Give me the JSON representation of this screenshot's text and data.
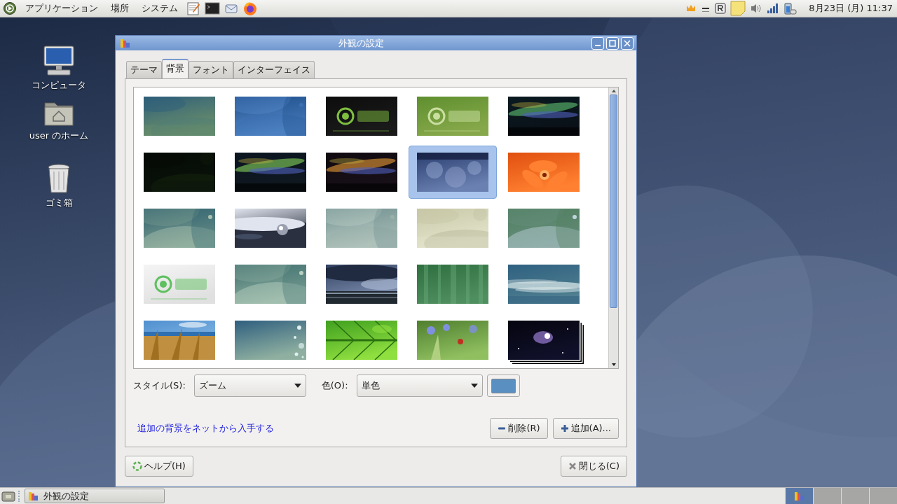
{
  "top_panel": {
    "menus": [
      {
        "label": "アプリケーション"
      },
      {
        "label": "場所"
      },
      {
        "label": "システム"
      }
    ],
    "clock": "8月23日 (月) 11:37"
  },
  "desktop_icons": [
    {
      "label": "コンピュータ",
      "kind": "computer"
    },
    {
      "label": "user のホーム",
      "kind": "home"
    },
    {
      "label": "ゴミ箱",
      "kind": "trash"
    }
  ],
  "dialog": {
    "title": "外観の設定",
    "tabs": [
      {
        "label": "テーマ",
        "selected": false
      },
      {
        "label": "背景",
        "selected": true
      },
      {
        "label": "フォント",
        "selected": false
      },
      {
        "label": "インターフェイス",
        "selected": false
      }
    ],
    "wallpapers": [
      {
        "kind": "picture",
        "selected": false
      },
      {
        "kind": "picture",
        "selected": false
      },
      {
        "kind": "picture",
        "selected": false
      },
      {
        "kind": "picture",
        "selected": false
      },
      {
        "kind": "picture",
        "selected": false
      },
      {
        "kind": "picture",
        "selected": false
      },
      {
        "kind": "picture",
        "selected": false
      },
      {
        "kind": "picture",
        "selected": false
      },
      {
        "kind": "picture",
        "selected": true
      },
      {
        "kind": "picture",
        "selected": false
      },
      {
        "kind": "picture",
        "selected": false
      },
      {
        "kind": "picture",
        "selected": false
      },
      {
        "kind": "picture",
        "selected": false
      },
      {
        "kind": "picture",
        "selected": false
      },
      {
        "kind": "picture",
        "selected": false
      },
      {
        "kind": "picture",
        "selected": false
      },
      {
        "kind": "picture",
        "selected": false
      },
      {
        "kind": "picture",
        "selected": false
      },
      {
        "kind": "picture",
        "selected": false
      },
      {
        "kind": "picture",
        "selected": false
      },
      {
        "kind": "picture",
        "selected": false
      },
      {
        "kind": "picture",
        "selected": false
      },
      {
        "kind": "picture",
        "selected": false
      },
      {
        "kind": "picture",
        "selected": false
      },
      {
        "kind": "picture",
        "selected": false
      }
    ],
    "style_label": "スタイル(S):",
    "style_value": "ズーム",
    "color_label": "色(O):",
    "color_value": "単色",
    "color_button": {
      "color": "#5a8fc2"
    },
    "link": "追加の背景をネットから入手する",
    "remove_button": "削除(R)",
    "add_button": "追加(A)...",
    "help_button": "ヘルプ(H)",
    "close_button": "閉じる(C)"
  },
  "taskbar": {
    "tasks": [
      {
        "label": "外観の設定"
      }
    ],
    "workspaces": [
      {
        "selected": true
      },
      {
        "selected": false
      },
      {
        "selected": false
      },
      {
        "selected": false
      }
    ]
  }
}
